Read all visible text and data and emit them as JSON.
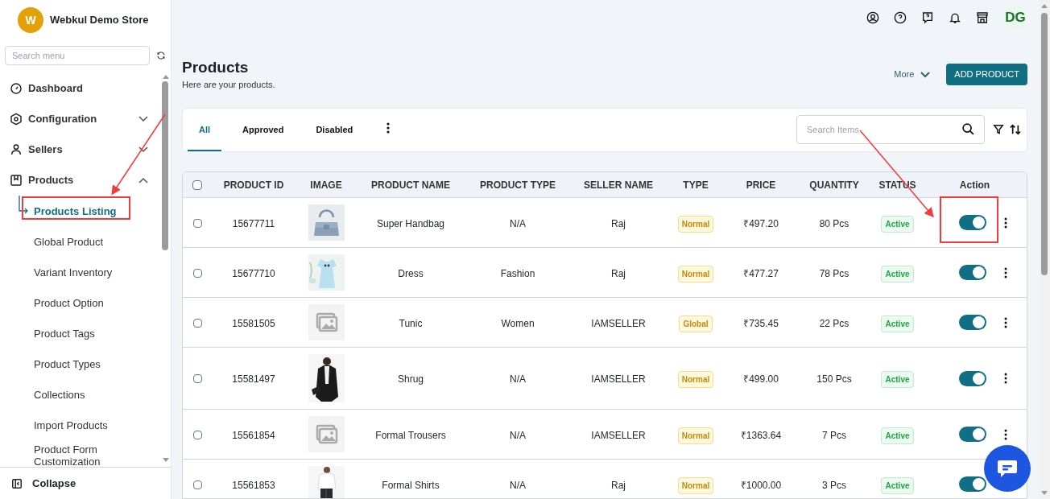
{
  "store": {
    "initial": "W",
    "name": "Webkul Demo Store"
  },
  "sidebar": {
    "search_placeholder": "Search menu",
    "items": [
      {
        "label": "Dashboard"
      },
      {
        "label": "Configuration",
        "expanded": false
      },
      {
        "label": "Sellers",
        "expanded": false
      },
      {
        "label": "Products",
        "expanded": true,
        "children": [
          {
            "label": "Products Listing",
            "selected": true
          },
          {
            "label": "Global Product",
            "selected": false
          },
          {
            "label": "Variant Inventory",
            "selected": false
          },
          {
            "label": "Product Option",
            "selected": false
          },
          {
            "label": "Product Tags",
            "selected": false
          },
          {
            "label": "Product Types",
            "selected": false
          },
          {
            "label": "Collections",
            "selected": false
          },
          {
            "label": "Import Products",
            "selected": false
          },
          {
            "label": "Product Form Customization",
            "selected": false
          }
        ]
      }
    ],
    "collapse": "Collapse"
  },
  "topbar": {
    "avatar": "DG"
  },
  "page": {
    "title": "Products",
    "subtitle": "Here are your products.",
    "more": "More",
    "add_button": "ADD PRODUCT"
  },
  "tabs": [
    {
      "label": "All",
      "selected": true
    },
    {
      "label": "Approved",
      "selected": false
    },
    {
      "label": "Disabled",
      "selected": false
    }
  ],
  "search": {
    "placeholder": "Search Items"
  },
  "table": {
    "select_all_checked": false,
    "columns": [
      "PRODUCT ID",
      "IMAGE",
      "PRODUCT NAME",
      "PRODUCT TYPE",
      "SELLER NAME",
      "TYPE",
      "PRICE",
      "QUANTITY",
      "STATUS",
      "Action"
    ],
    "rows": [
      {
        "checked": false,
        "id": "15677711",
        "name": "Super Handbag",
        "product_type": "N/A",
        "seller": "Raj",
        "type": "Normal",
        "price": "₹497.20",
        "quantity": "80 Pcs",
        "status": "Active",
        "enabled": true
      },
      {
        "checked": false,
        "id": "15677710",
        "name": "Dress",
        "product_type": "Fashion",
        "seller": "Raj",
        "type": "Normal",
        "price": "₹477.27",
        "quantity": "78 Pcs",
        "status": "Active",
        "enabled": true
      },
      {
        "checked": false,
        "id": "15581505",
        "image": {
          "kind": "placeholder"
        },
        "name": "Tunic",
        "product_type": "Women",
        "seller": "IAMSELLER",
        "type": "Global",
        "price": "₹735.45",
        "quantity": "22 Pcs",
        "status": "Active",
        "enabled": true
      },
      {
        "checked": false,
        "id": "15581497",
        "name": "Shrug",
        "product_type": "N/A",
        "seller": "IAMSELLER",
        "type": "Normal",
        "price": "₹499.00",
        "quantity": "150 Pcs",
        "status": "Active",
        "enabled": true
      },
      {
        "checked": false,
        "id": "15561854",
        "image": {
          "kind": "placeholder"
        },
        "name": "Formal Trousers",
        "product_type": "N/A",
        "seller": "IAMSELLER",
        "type": "Normal",
        "price": "₹1363.64",
        "quantity": "7 Pcs",
        "status": "Active",
        "enabled": true
      },
      {
        "checked": false,
        "id": "15561853",
        "name": "Formal Shirts",
        "product_type": "N/A",
        "seller": "Raj",
        "type": "Normal",
        "price": "₹1000.00",
        "quantity": "3 Pcs",
        "status": "Active",
        "enabled": true
      }
    ]
  }
}
